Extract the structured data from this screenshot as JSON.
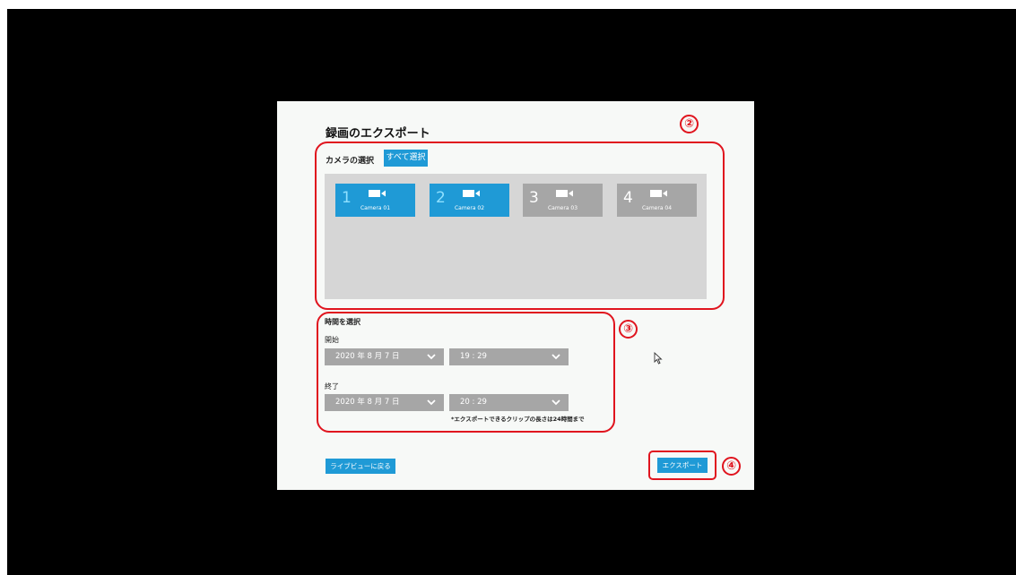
{
  "dialog": {
    "title": "録画のエクスポート"
  },
  "camera_select": {
    "label": "カメラの選択",
    "select_all_label": "すべて選択",
    "cameras": [
      {
        "number": "1",
        "name": "Camera 01",
        "selected": true
      },
      {
        "number": "2",
        "name": "Camera 02",
        "selected": true
      },
      {
        "number": "3",
        "name": "Camera 03",
        "selected": false
      },
      {
        "number": "4",
        "name": "Camera 04",
        "selected": false
      }
    ]
  },
  "time_select": {
    "label": "時間を選択",
    "start": {
      "label": "開始",
      "date": "2020 年 8 月 7 日",
      "time": "19 : 29"
    },
    "end": {
      "label": "終了",
      "date": "2020 年 8 月 7 日",
      "time": "20 : 29"
    },
    "note": "*エクスポートできるクリップの長さは24時間まで"
  },
  "buttons": {
    "back_live_label": "ライブビューに戻る",
    "export_label": "エクスポート"
  },
  "annotations": {
    "section_2": "②",
    "section_3": "③",
    "section_4": "④"
  },
  "colors": {
    "accent": "#1f9ad6",
    "annotation": "#e0141e",
    "unselected": "#a6a6a6"
  },
  "icons": [
    "video-camera-icon",
    "chevron-down-icon",
    "mouse-cursor-icon"
  ]
}
